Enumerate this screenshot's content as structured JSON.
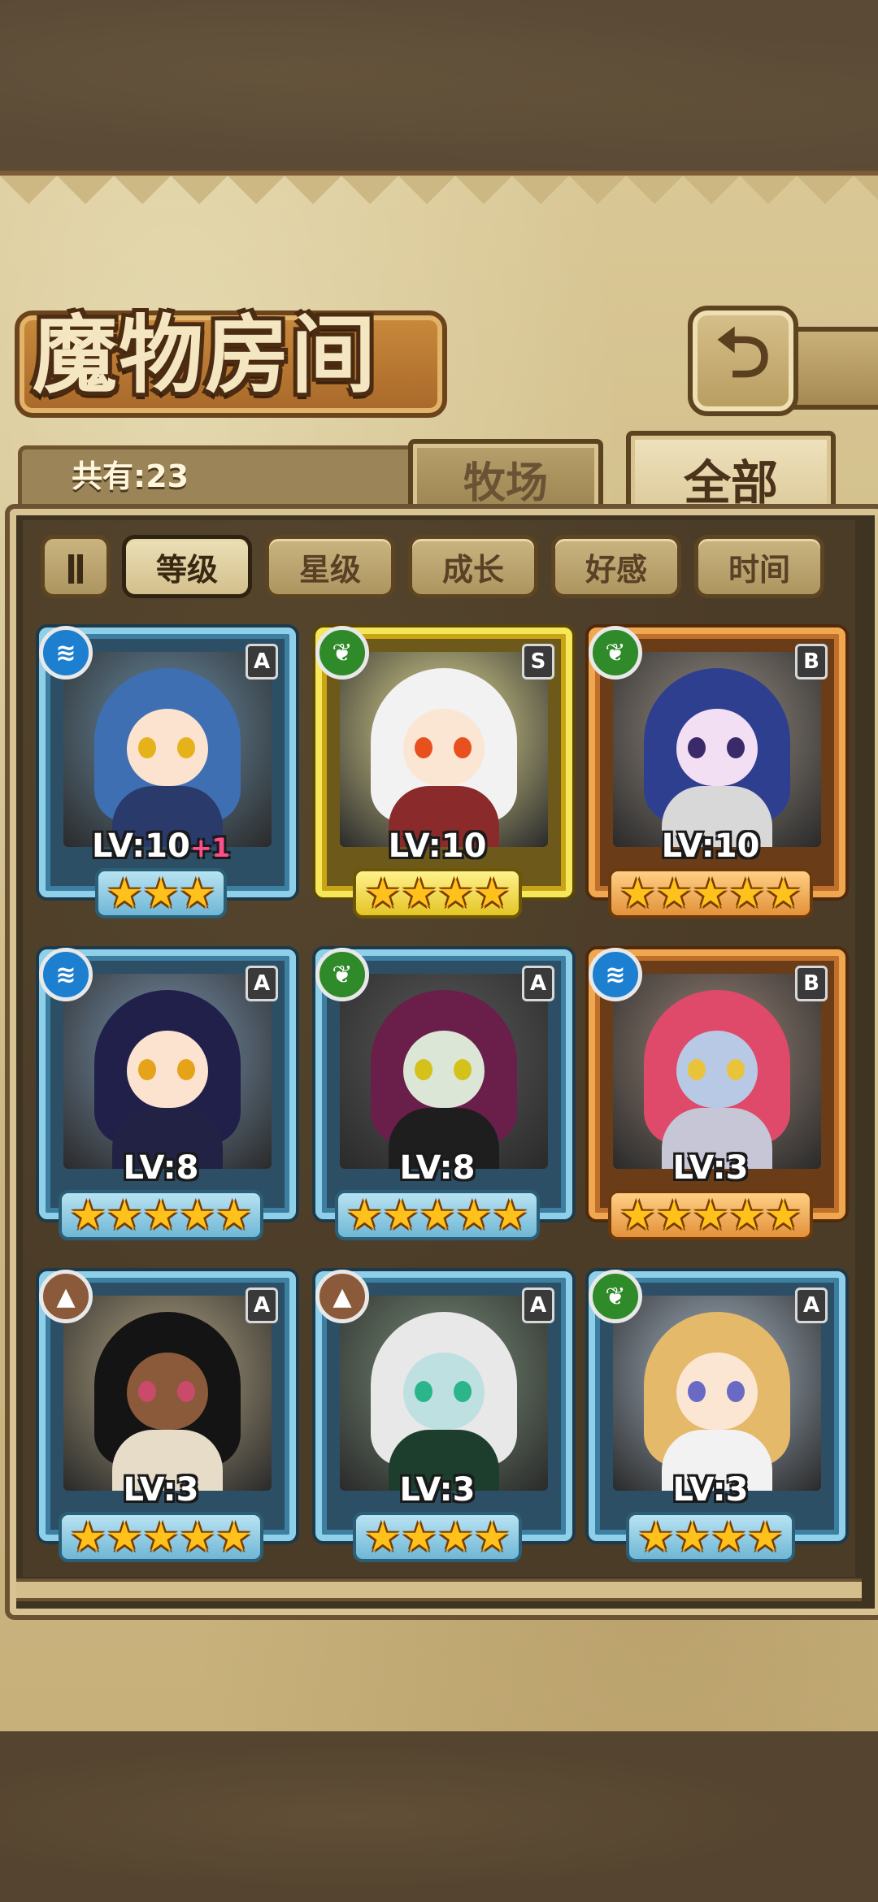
{
  "header": {
    "title": "魔物房间",
    "back_icon": "back-arrow-icon"
  },
  "summary": {
    "count_label": "共有:23"
  },
  "tabs": [
    {
      "label": "牧场",
      "active": false
    },
    {
      "label": "全部",
      "active": true
    }
  ],
  "sort": {
    "toggle_icon": "ǁ",
    "options": [
      {
        "label": "等级",
        "active": true
      },
      {
        "label": "星级",
        "active": false
      },
      {
        "label": "成长",
        "active": false
      },
      {
        "label": "好感",
        "active": false
      },
      {
        "label": "时间",
        "active": false
      }
    ]
  },
  "monsters": [
    {
      "rank": "A",
      "element": "water",
      "level": "LV:10",
      "bonus": "+1",
      "stars": 3,
      "frame": "blue"
    },
    {
      "rank": "S",
      "element": "wood",
      "level": "LV:10",
      "bonus": "",
      "stars": 4,
      "frame": "gold"
    },
    {
      "rank": "B",
      "element": "wood",
      "level": "LV:10",
      "bonus": "",
      "stars": 5,
      "frame": "orange"
    },
    {
      "rank": "A",
      "element": "water",
      "level": "LV:8",
      "bonus": "",
      "stars": 5,
      "frame": "blue"
    },
    {
      "rank": "A",
      "element": "wood",
      "level": "LV:8",
      "bonus": "",
      "stars": 5,
      "frame": "blue"
    },
    {
      "rank": "B",
      "element": "water",
      "level": "LV:3",
      "bonus": "",
      "stars": 5,
      "frame": "orange"
    },
    {
      "rank": "A",
      "element": "earth",
      "level": "LV:3",
      "bonus": "",
      "stars": 5,
      "frame": "blue"
    },
    {
      "rank": "A",
      "element": "earth",
      "level": "LV:3",
      "bonus": "",
      "stars": 4,
      "frame": "blue"
    },
    {
      "rank": "A",
      "element": "wood",
      "level": "LV:3",
      "bonus": "",
      "stars": 4,
      "frame": "blue"
    }
  ],
  "colors": {
    "water": "#1d7fd0",
    "wood": "#2f8a2a",
    "earth": "#8a5a3a"
  }
}
